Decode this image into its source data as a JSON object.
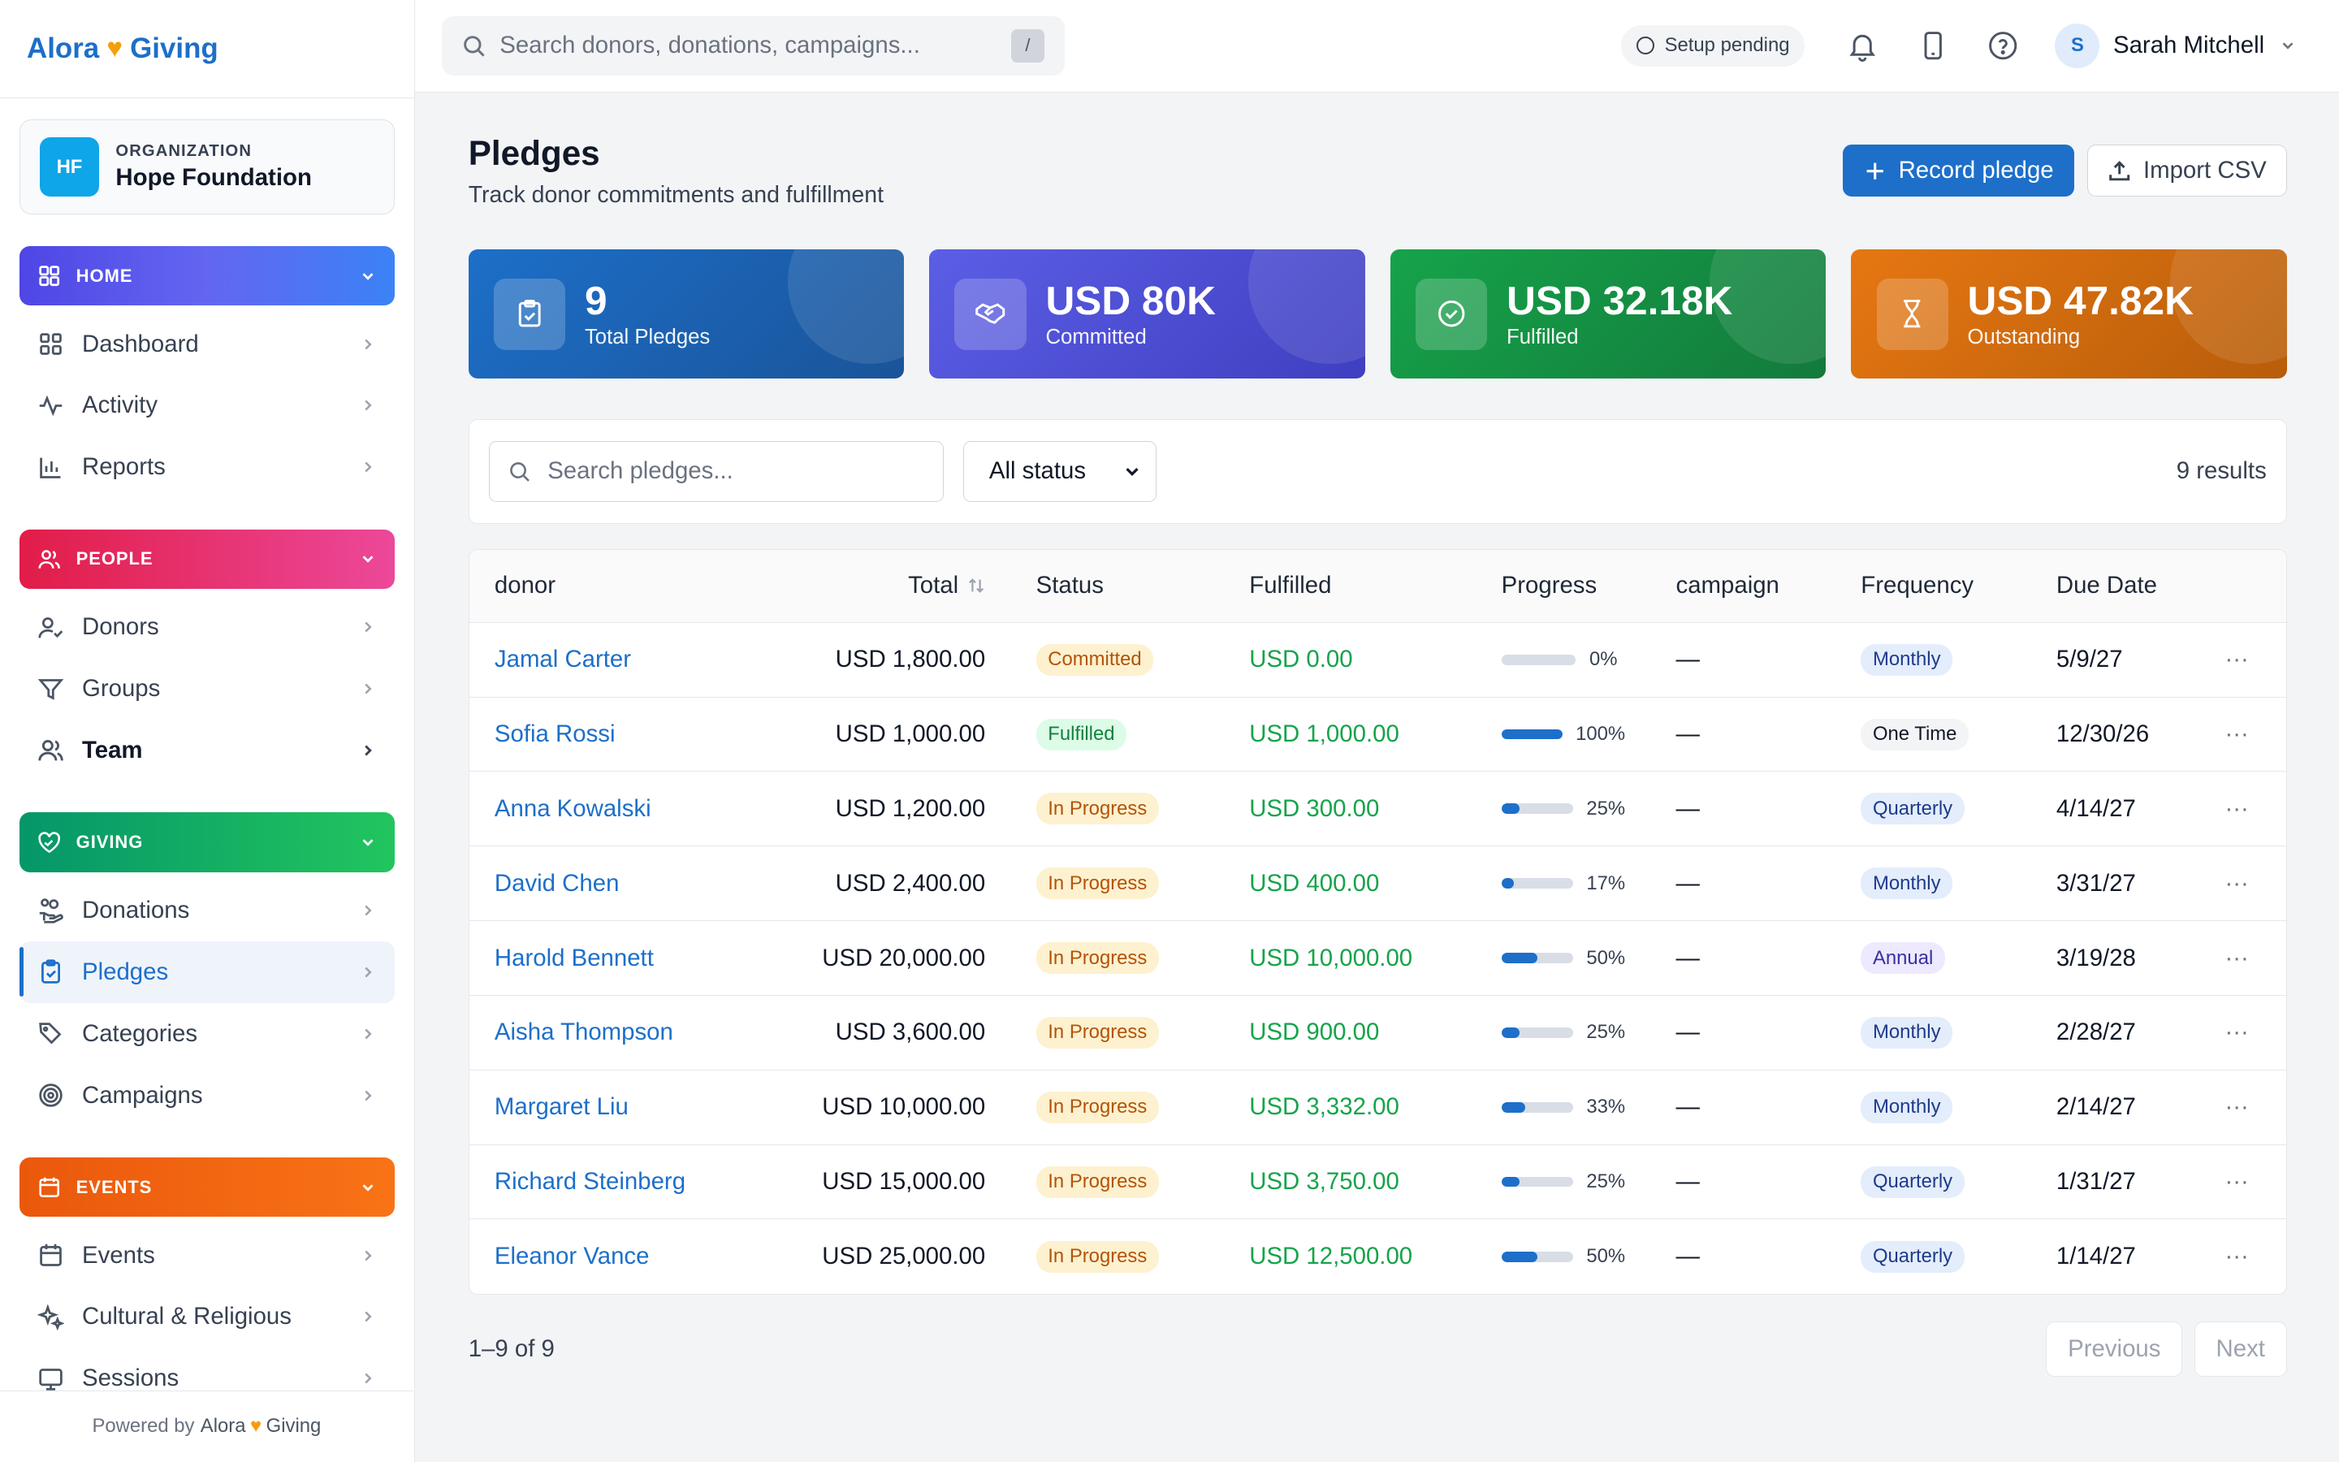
{
  "brand": {
    "name_left": "Alora",
    "name_right": "Giving"
  },
  "org": {
    "initials": "HF",
    "label": "ORGANIZATION",
    "name": "Hope Foundation"
  },
  "sections": {
    "home": {
      "label": "HOME",
      "items": [
        "Dashboard",
        "Activity",
        "Reports"
      ]
    },
    "people": {
      "label": "PEOPLE",
      "items": [
        "Donors",
        "Groups",
        "Team"
      ]
    },
    "giving": {
      "label": "GIVING",
      "items": [
        "Donations",
        "Pledges",
        "Categories",
        "Campaigns"
      ]
    },
    "events": {
      "label": "EVENTS",
      "items": [
        "Events",
        "Cultural & Religious",
        "Sessions"
      ]
    }
  },
  "footer": {
    "prefix": "Powered by",
    "brand_left": "Alora",
    "brand_right": "Giving"
  },
  "topbar": {
    "search_placeholder": "Search donors, donations, campaigns...",
    "shortcut": "/",
    "setup_status": "Setup pending",
    "user_initial": "S",
    "user_name": "Sarah Mitchell"
  },
  "page": {
    "title": "Pledges",
    "subtitle": "Track donor commitments and fulfillment",
    "record_button": "Record pledge",
    "import_button": "Import CSV"
  },
  "stats": [
    {
      "value": "9",
      "label": "Total Pledges"
    },
    {
      "value": "USD 80K",
      "label": "Committed"
    },
    {
      "value": "USD 32.18K",
      "label": "Fulfilled"
    },
    {
      "value": "USD 47.82K",
      "label": "Outstanding"
    }
  ],
  "filters": {
    "search_placeholder": "Search pledges...",
    "status_value": "All status",
    "results": "9 results"
  },
  "table": {
    "headers": {
      "donor": "donor",
      "total": "Total",
      "status": "Status",
      "fulfilled": "Fulfilled",
      "progress": "Progress",
      "campaign": "campaign",
      "frequency": "Frequency",
      "due": "Due Date"
    },
    "rows": [
      {
        "donor": "Jamal Carter",
        "total": "USD 1,800.00",
        "status": "Committed",
        "fulfilled": "USD 0.00",
        "progress": 0,
        "progress_label": "0%",
        "campaign": "—",
        "frequency": "Monthly",
        "due": "5/9/27"
      },
      {
        "donor": "Sofia Rossi",
        "total": "USD 1,000.00",
        "status": "Fulfilled",
        "fulfilled": "USD 1,000.00",
        "progress": 100,
        "progress_label": "100%",
        "campaign": "—",
        "frequency": "One Time",
        "due": "12/30/26"
      },
      {
        "donor": "Anna Kowalski",
        "total": "USD 1,200.00",
        "status": "In Progress",
        "fulfilled": "USD 300.00",
        "progress": 25,
        "progress_label": "25%",
        "campaign": "—",
        "frequency": "Quarterly",
        "due": "4/14/27"
      },
      {
        "donor": "David Chen",
        "total": "USD 2,400.00",
        "status": "In Progress",
        "fulfilled": "USD 400.00",
        "progress": 17,
        "progress_label": "17%",
        "campaign": "—",
        "frequency": "Monthly",
        "due": "3/31/27"
      },
      {
        "donor": "Harold Bennett",
        "total": "USD 20,000.00",
        "status": "In Progress",
        "fulfilled": "USD 10,000.00",
        "progress": 50,
        "progress_label": "50%",
        "campaign": "—",
        "frequency": "Annual",
        "due": "3/19/28"
      },
      {
        "donor": "Aisha Thompson",
        "total": "USD 3,600.00",
        "status": "In Progress",
        "fulfilled": "USD 900.00",
        "progress": 25,
        "progress_label": "25%",
        "campaign": "—",
        "frequency": "Monthly",
        "due": "2/28/27"
      },
      {
        "donor": "Margaret Liu",
        "total": "USD 10,000.00",
        "status": "In Progress",
        "fulfilled": "USD 3,332.00",
        "progress": 33,
        "progress_label": "33%",
        "campaign": "—",
        "frequency": "Monthly",
        "due": "2/14/27"
      },
      {
        "donor": "Richard Steinberg",
        "total": "USD 15,000.00",
        "status": "In Progress",
        "fulfilled": "USD 3,750.00",
        "progress": 25,
        "progress_label": "25%",
        "campaign": "—",
        "frequency": "Quarterly",
        "due": "1/31/27"
      },
      {
        "donor": "Eleanor Vance",
        "total": "USD 25,000.00",
        "status": "In Progress",
        "fulfilled": "USD 12,500.00",
        "progress": 50,
        "progress_label": "50%",
        "campaign": "—",
        "frequency": "Quarterly",
        "due": "1/14/27"
      }
    ],
    "row_menu": "···"
  },
  "pagination": {
    "summary": "1–9 of 9",
    "previous": "Previous",
    "next": "Next"
  },
  "colors": {
    "accent": "#1d6fc9",
    "success": "#16a34a",
    "warning": "#b45309"
  }
}
